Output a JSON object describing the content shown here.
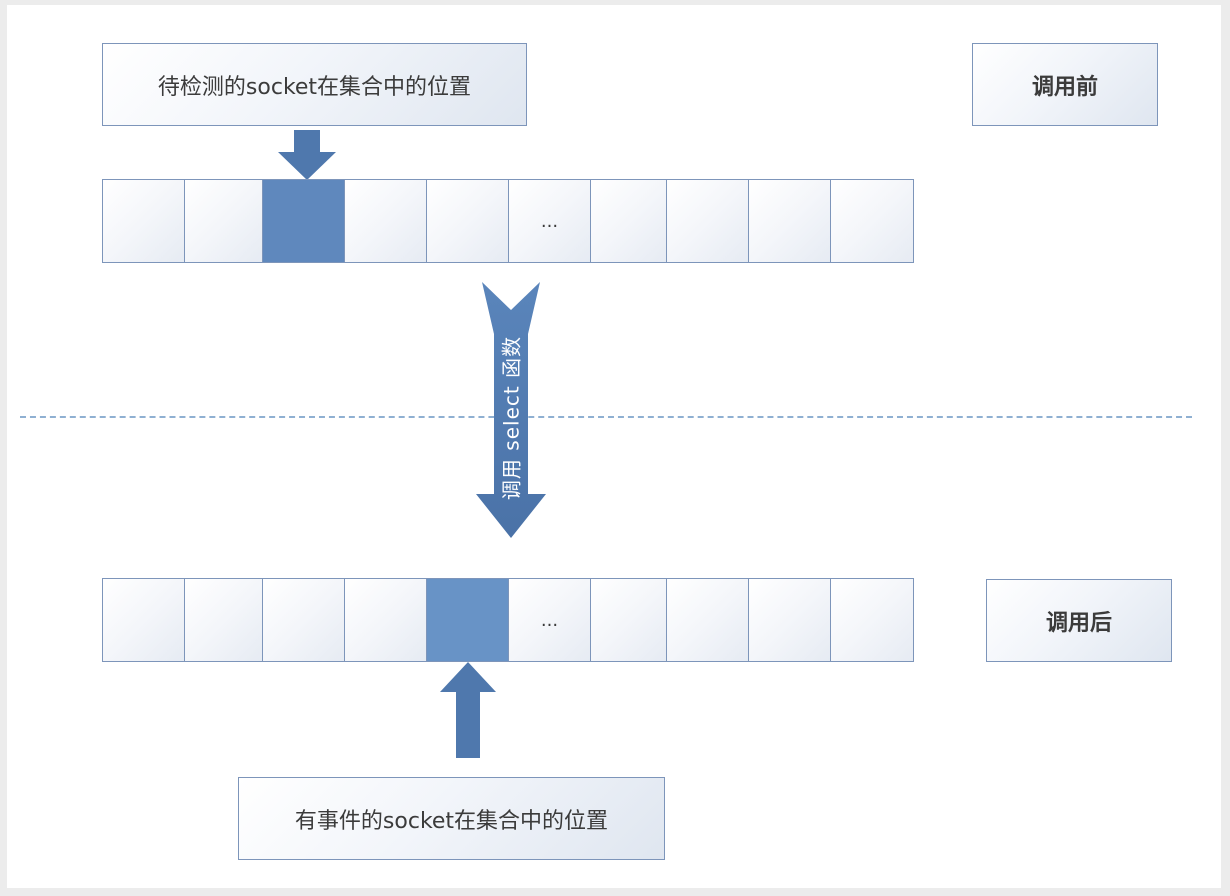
{
  "top_label": "待检测的socket在集合中的位置",
  "before_label": "调用前",
  "after_label": "调用后",
  "bottom_label": "有事件的socket在集合中的位置",
  "call_label": "调用 select 函数",
  "top_array": {
    "cells": [
      "",
      "",
      "",
      "",
      "",
      "...",
      "",
      "",
      "",
      ""
    ],
    "highlighted_index": 2
  },
  "bottom_array": {
    "cells": [
      "",
      "",
      "",
      "",
      "",
      "...",
      "",
      "",
      "",
      ""
    ],
    "highlighted_index": 4
  },
  "colors": {
    "highlight": "#6893c6",
    "arrow": "#4f78ad",
    "border": "#7d95ba",
    "dashed_line": "#8fb0d2"
  }
}
